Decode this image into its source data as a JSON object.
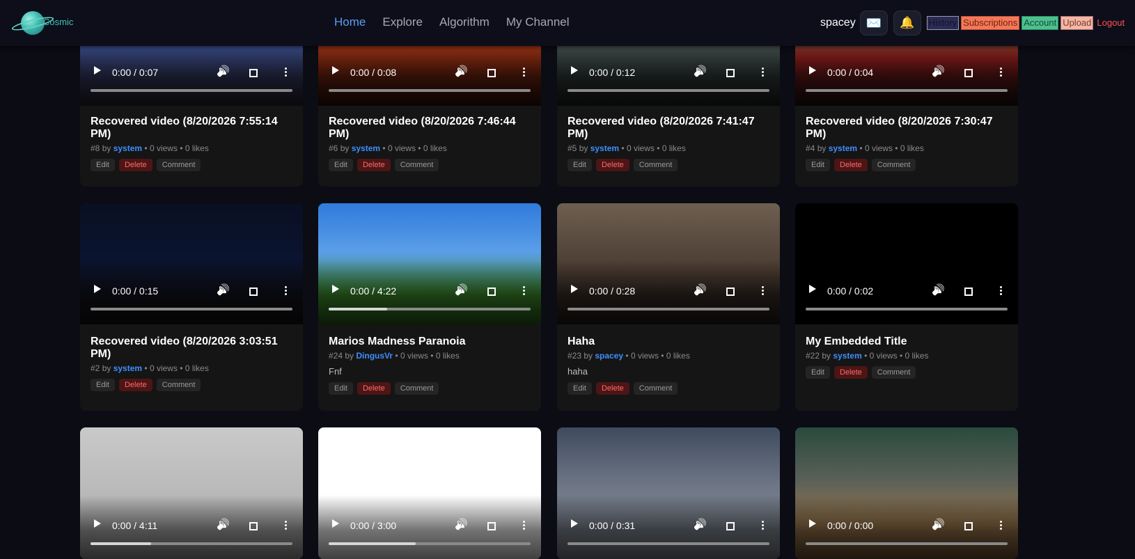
{
  "header": {
    "logo_text": "Cosmic",
    "nav": [
      "Home",
      "Explore",
      "Algorithm",
      "My Channel"
    ],
    "username": "spacey",
    "mail_icon": "✉️",
    "bell_icon": "🔔",
    "buttons": {
      "history": "History",
      "subscriptions": "Subscriptions",
      "account": "Account",
      "upload": "Upload",
      "logout": "Logout"
    }
  },
  "action_labels": {
    "edit": "Edit",
    "delete": "Delete",
    "comment": "Comment"
  },
  "videos": [
    {
      "title": "Recovered video (8/20/2026 7:55:14 PM)",
      "id": "#8",
      "author": "system",
      "stats": "• 0 views • 0 likes",
      "time": "0:00 / 0:07",
      "progress": 0
    },
    {
      "title": "Recovered video (8/20/2026 7:46:44 PM)",
      "id": "#6",
      "author": "system",
      "stats": "• 0 views • 0 likes",
      "time": "0:00 / 0:08",
      "progress": 0
    },
    {
      "title": "Recovered video (8/20/2026 7:41:47 PM)",
      "id": "#5",
      "author": "system",
      "stats": "• 0 views • 0 likes",
      "time": "0:00 / 0:12",
      "progress": 0
    },
    {
      "title": "Recovered video (8/20/2026 7:30:47 PM)",
      "id": "#4",
      "author": "system",
      "stats": "• 0 views • 0 likes",
      "time": "0:00 / 0:04",
      "progress": 0
    },
    {
      "title": "Recovered video (8/20/2026 3:03:51 PM)",
      "id": "#2",
      "author": "system",
      "stats": "• 0 views • 0 likes",
      "time": "0:00 / 0:15",
      "progress": 0
    },
    {
      "title": "Marios Madness Paranoia",
      "id": "#24",
      "author": "DingusVr",
      "stats": "• 0 views • 0 likes",
      "description": "Fnf",
      "time": "0:00 / 4:22",
      "progress": 0.29
    },
    {
      "title": "Haha",
      "id": "#23",
      "author": "spacey",
      "stats": "• 0 views • 0 likes",
      "description": "haha",
      "time": "0:00 / 0:28",
      "progress": 0
    },
    {
      "title": "My Embedded Title",
      "id": "#22",
      "author": "system",
      "stats": "• 0 views • 0 likes",
      "time": "0:00 / 0:02",
      "progress": 0
    },
    {
      "time": "0:00 / 4:11",
      "progress": 0.3
    },
    {
      "time": "0:00 / 3:00",
      "progress": 0.43
    },
    {
      "time": "0:00 / 0:31",
      "progress": 0
    },
    {
      "time": "0:00 / 0:00",
      "progress": 0
    }
  ]
}
